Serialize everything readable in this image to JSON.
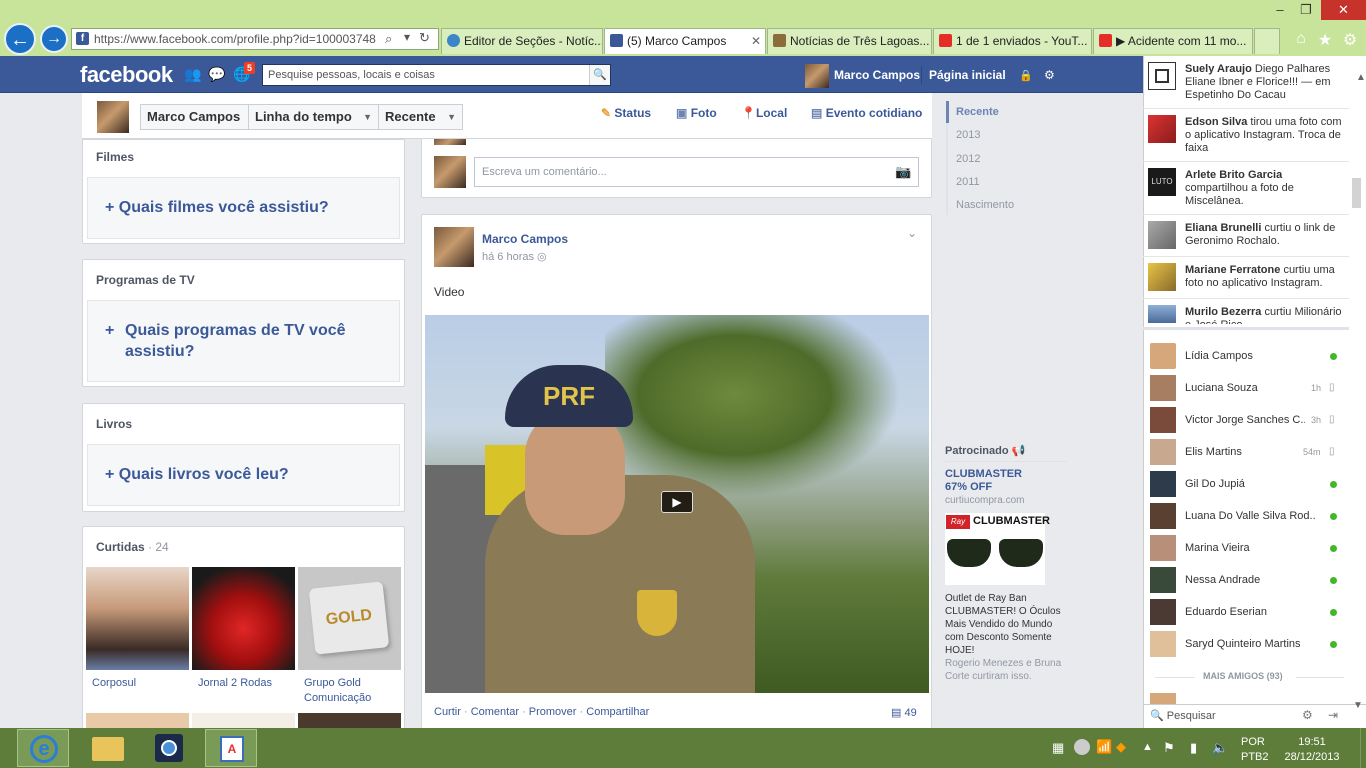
{
  "browser": {
    "address": "https://www.facebook.com/profile.php?id=100003748",
    "tabs": [
      {
        "label": "Editor de Seções - Notíc..."
      },
      {
        "label": "(5) Marco Campos",
        "close": "✕"
      },
      {
        "label": "Notícias de Três Lagoas..."
      },
      {
        "label": "1 de 1 enviados - YouT..."
      },
      {
        "label": "Acidente com 11 mo..."
      }
    ],
    "window_buttons": [
      "–",
      "❐",
      "✕"
    ]
  },
  "fb": {
    "logo": "facebook",
    "notif_count": "5",
    "search_placeholder": "Pesquise pessoas, locais e coisas",
    "user_name": "Marco Campos",
    "home": "Página inicial"
  },
  "profile_header": {
    "name_btn": "Marco Campos",
    "timeline_btn": "Linha do tempo",
    "recent_btn": "Recente",
    "composer": [
      "Status",
      "Foto",
      "Local",
      "Evento cotidiano"
    ]
  },
  "left": {
    "movies": {
      "title": "Filmes",
      "question": "Quais filmes você assistiu?"
    },
    "tv": {
      "title": "Programas de TV",
      "question": "Quais programas de TV você assistiu?"
    },
    "books": {
      "title": "Livros",
      "question": "Quais livros você leu?"
    },
    "likes": {
      "title": "Curtidas",
      "count": "· 24",
      "items": [
        "Corposul",
        "Jornal 2 Rodas",
        "Grupo Gold Comunicação"
      ],
      "gold_logo": "GOLD"
    }
  },
  "feed": {
    "comment_placeholder": "Escreva um comentário...",
    "post": {
      "author": "Marco Campos",
      "time": "há 6 horas",
      "text": "Video",
      "actions": [
        "Curtir",
        "Comentar",
        "Promover",
        "Compartilhar"
      ],
      "comments_count": "49",
      "cap_text": "PRF"
    }
  },
  "timeline_nav": {
    "items": [
      "Recente",
      "2013",
      "2012",
      "2011",
      "Nascimento"
    ]
  },
  "sponsored": {
    "label": "Patrocinado",
    "title": "CLUBMASTER",
    "discount": "67% OFF",
    "domain": "curtiucompra.com",
    "brand": "CLUBMASTER",
    "body": "Outlet de Ray Ban CLUBMASTER! O Óculos Mais Vendido do Mundo com Desconto Somente HOJE!",
    "social": "Rogerio Menezes e Bruna Corte curtiram isso."
  },
  "ticker": [
    {
      "name": "Suely Araujo",
      "text": "Diego Palhares Eliane Ibner e Florice!!! — em Espetinho Do Cacau"
    },
    {
      "name": "Edson Silva",
      "text": "tirou uma foto com o aplicativo Instagram. Troca de faixa"
    },
    {
      "name": "Arlete Brito Garcia",
      "text": "compartilhou a foto de Miscelânea.",
      "thumb": "LUTO"
    },
    {
      "name": "Eliana Brunelli",
      "text": "curtiu o link de Geronimo Rochalo."
    },
    {
      "name": "Mariane Ferratone",
      "text": "curtiu uma foto no aplicativo Instagram."
    },
    {
      "name": "Murilo Bezerra",
      "text": "curtiu Milionário e José Rico"
    }
  ],
  "chat": {
    "friends": [
      {
        "name": "Lídia Campos",
        "status": ""
      },
      {
        "name": "Luciana Souza",
        "status": "1h"
      },
      {
        "name": "Victor Jorge Sanches C...",
        "status": "3h"
      },
      {
        "name": "Elis Martins",
        "status": "54m"
      },
      {
        "name": "Gil Do Jupiá",
        "status": ""
      },
      {
        "name": "Luana Do Valle Silva Rod...",
        "status": ""
      },
      {
        "name": "Marina Vieira",
        "status": ""
      },
      {
        "name": "Nessa Andrade",
        "status": ""
      },
      {
        "name": "Eduardo Eserian",
        "status": ""
      },
      {
        "name": "Saryd Quinteiro Martins",
        "status": ""
      }
    ],
    "more": "MAIS AMIGOS (93)",
    "search_placeholder": "Pesquisar"
  },
  "taskbar": {
    "lang": "POR",
    "layout": "PTB2",
    "time": "19:51",
    "date": "28/12/2013"
  },
  "colors": {
    "fb_blue": "#3b5998",
    "ie_green": "#c8e39a",
    "taskbar": "#5e7d3a",
    "online": "#42b72a"
  }
}
